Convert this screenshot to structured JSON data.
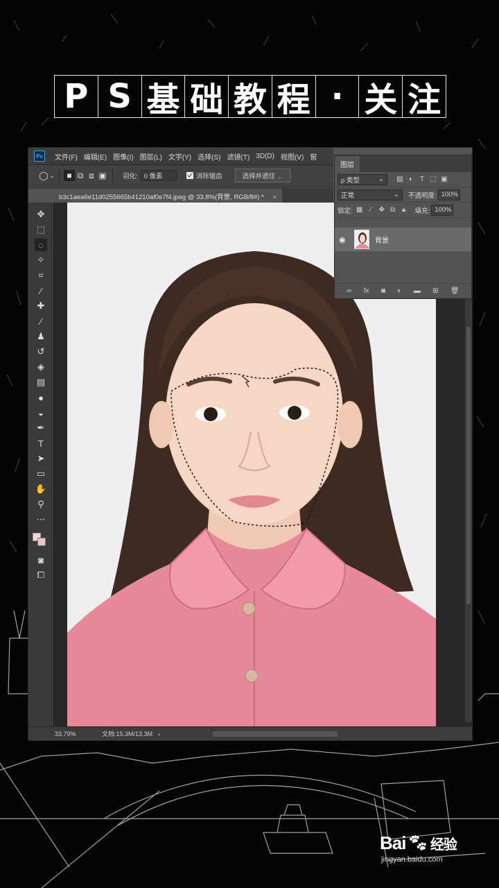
{
  "title_chars": [
    "P",
    "S",
    "基",
    "础",
    "教",
    "程",
    "·",
    "关",
    "注"
  ],
  "menu": [
    "文件(F)",
    "编辑(E)",
    "图像(I)",
    "图层(L)",
    "文字(Y)",
    "选择(S)",
    "滤镜(T)",
    "3D(D)",
    "视图(V)",
    "窗"
  ],
  "options": {
    "feather_label": "羽化:",
    "feather_value": "0 像素",
    "antialias_label": "消除锯齿",
    "select_mask_button": "选择并遮住 ..."
  },
  "document_tab": {
    "title": "b3c1aea6e11d0255665b41210af0e7f4.jpeg @ 33.8%(背景, RGB/8#) *",
    "close": "×"
  },
  "status": {
    "zoom": "33.79%",
    "doc": "文档:15.3M/13.3M"
  },
  "layers_panel": {
    "tab": "图层",
    "filter_label": "ρ 类型",
    "blend_mode": "正常",
    "opacity_label": "不透明度:",
    "opacity_value": "100%",
    "lock_label": "锁定:",
    "fill_label": "填充:",
    "fill_value": "100%",
    "layer_name": "背景",
    "footer_icons": [
      "link-icon",
      "fx-icon",
      "mask-icon",
      "adjustment-icon",
      "folder-icon",
      "new-layer-icon",
      "trash-icon"
    ]
  },
  "watermark": {
    "brand": "Bai",
    "brand_suffix": "经验",
    "url": "jingyan.baidu.com"
  },
  "colors": {
    "ps_panel": "#535353",
    "ps_dark": "#3c3c3c",
    "shirt": "#e8899a",
    "photo_bg": "#efeef0"
  }
}
